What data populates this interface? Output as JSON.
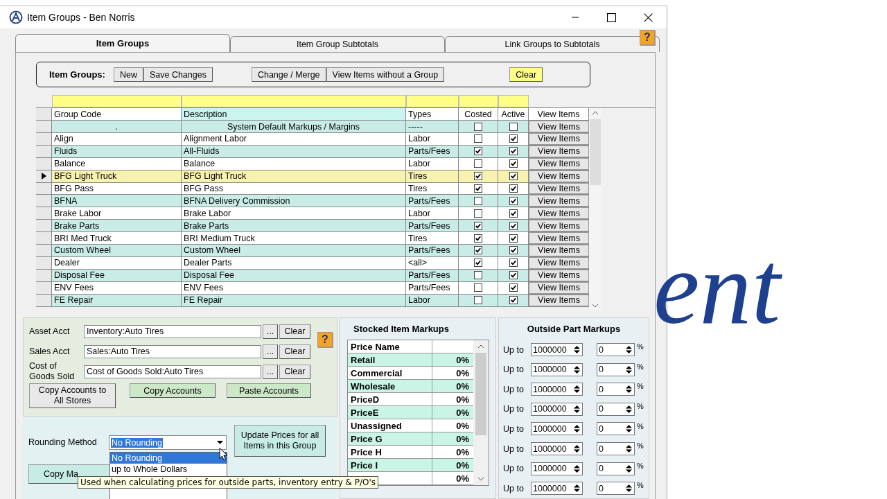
{
  "window": {
    "title": "Item Groups - Ben Norris",
    "help": "?"
  },
  "tabs": [
    {
      "label": "Item Groups",
      "selected": true
    },
    {
      "label": "Item Group Subtotals",
      "selected": false
    },
    {
      "label": "Link Groups to Subtotals",
      "selected": false
    }
  ],
  "toolbar": {
    "label": "Item Groups:",
    "buttons": [
      {
        "label": "New",
        "kind": "plain"
      },
      {
        "label": "Save Changes",
        "kind": "plain"
      },
      {
        "label": "Change / Merge",
        "kind": "plain"
      },
      {
        "label": "View Items without a Group",
        "kind": "plain"
      },
      {
        "label": "Clear",
        "kind": "highlight"
      }
    ]
  },
  "table": {
    "columns": [
      "Group Code",
      "Description",
      "Types",
      "Costed",
      "Active",
      "View Items"
    ],
    "rows": [
      {
        "group_code": ".",
        "description": "System Default Markups / Margins",
        "types": "-----",
        "costed": false,
        "active": false,
        "action": "View Items",
        "selected": false
      },
      {
        "group_code": "Align",
        "description": "Alignment Labor",
        "types": "Labor",
        "costed": false,
        "active": true,
        "action": "View Items",
        "selected": false
      },
      {
        "group_code": "Fluids",
        "description": "All-Fluids",
        "types": "Parts/Fees",
        "costed": true,
        "active": true,
        "action": "View Items",
        "selected": false
      },
      {
        "group_code": "Balance",
        "description": "Balance",
        "types": "Labor",
        "costed": false,
        "active": true,
        "action": "View Items",
        "selected": false
      },
      {
        "group_code": "BFG Light Truck",
        "description": "BFG Light Truck",
        "types": "Tires",
        "costed": true,
        "active": true,
        "action": "View Items",
        "selected": true
      },
      {
        "group_code": "BFG Pass",
        "description": "BFG Pass",
        "types": "Tires",
        "costed": true,
        "active": true,
        "action": "View Items",
        "selected": false
      },
      {
        "group_code": "BFNA",
        "description": "BFNA Delivery Commission",
        "types": "Parts/Fees",
        "costed": false,
        "active": true,
        "action": "View Items",
        "selected": false
      },
      {
        "group_code": "Brake Labor",
        "description": "Brake Labor",
        "types": "Labor",
        "costed": false,
        "active": true,
        "action": "View Items",
        "selected": false
      },
      {
        "group_code": "Brake Parts",
        "description": "Brake Parts",
        "types": "Parts/Fees",
        "costed": true,
        "active": true,
        "action": "View Items",
        "selected": false
      },
      {
        "group_code": "BRI Med Truck",
        "description": "BRI Medium Truck",
        "types": "Tires",
        "costed": true,
        "active": true,
        "action": "View Items",
        "selected": false
      },
      {
        "group_code": "Custom Wheel",
        "description": "Custom Wheel",
        "types": "Parts/Fees",
        "costed": true,
        "active": true,
        "action": "View Items",
        "selected": false
      },
      {
        "group_code": "Dealer",
        "description": "Dealer Parts",
        "types": "<all>",
        "costed": true,
        "active": true,
        "action": "View Items",
        "selected": false
      },
      {
        "group_code": "Disposal Fee",
        "description": "Disposal Fee",
        "types": "Parts/Fees",
        "costed": false,
        "active": true,
        "action": "View Items",
        "selected": false
      },
      {
        "group_code": "ENV Fees",
        "description": "ENV Fees",
        "types": "Parts/Fees",
        "costed": false,
        "active": true,
        "action": "View Items",
        "selected": false
      },
      {
        "group_code": "FE Repair",
        "description": "FE Repair",
        "types": "Labor",
        "costed": false,
        "active": true,
        "action": "View Items",
        "selected": false
      }
    ]
  },
  "accounts": {
    "fields": [
      {
        "label": "Asset Acct",
        "value": "Inventory:Auto Tires",
        "browse": "...",
        "clear": "Clear"
      },
      {
        "label": "Sales Acct",
        "value": "Sales:Auto Tires",
        "browse": "...",
        "clear": "Clear"
      },
      {
        "label": "Cost of Goods Sold",
        "value": "Cost of Goods Sold:Auto Tires",
        "browse": "...",
        "clear": "Clear"
      }
    ],
    "buttons": [
      "Copy Accounts to All Stores",
      "Copy Accounts",
      "Paste Accounts"
    ],
    "help": "?"
  },
  "rounding": {
    "label": "Rounding Method",
    "value": "No Rounding",
    "options": [
      {
        "label": "No Rounding",
        "selected": true
      },
      {
        "label": "up to Whole Dollars",
        "selected": false
      }
    ],
    "update_button": "Update Prices for all Items in this Group",
    "copy_button": "Copy Ma"
  },
  "tooltip": "Used when calculating prices for outside parts, inventory entry & P/O's",
  "stocked": {
    "title": "Stocked Item Markups",
    "header": "Price Name",
    "rows": [
      {
        "name": "Retail",
        "value": "0%"
      },
      {
        "name": "Commercial",
        "value": "0%"
      },
      {
        "name": "Wholesale",
        "value": "0%"
      },
      {
        "name": "PriceD",
        "value": "0%"
      },
      {
        "name": "PriceE",
        "value": "0%"
      },
      {
        "name": "Unassigned",
        "value": "0%"
      },
      {
        "name": "Price G",
        "value": "0%"
      },
      {
        "name": "Price H",
        "value": "0%"
      },
      {
        "name": "Price I",
        "value": "0%"
      },
      {
        "value": "0%"
      }
    ]
  },
  "outside": {
    "title": "Outside Part Markups",
    "rows": [
      {
        "label": "Up to",
        "limit": "1000000",
        "percent": "0",
        "unit": "%"
      },
      {
        "label": "Up to",
        "limit": "1000000",
        "percent": "0",
        "unit": "%"
      },
      {
        "label": "Up to",
        "limit": "1000000",
        "percent": "0",
        "unit": "%"
      },
      {
        "label": "Up to",
        "limit": "1000000",
        "percent": "0",
        "unit": "%"
      },
      {
        "label": "Up to",
        "limit": "1000000",
        "percent": "0",
        "unit": "%"
      },
      {
        "label": "Up to",
        "limit": "1000000",
        "percent": "0",
        "unit": "%"
      },
      {
        "label": "Up to",
        "limit": "1000000",
        "percent": "0",
        "unit": "%"
      },
      {
        "label": "Up to",
        "limit": "1000000",
        "percent": "0",
        "unit": "%"
      }
    ]
  },
  "background": {
    "text": "ent"
  }
}
